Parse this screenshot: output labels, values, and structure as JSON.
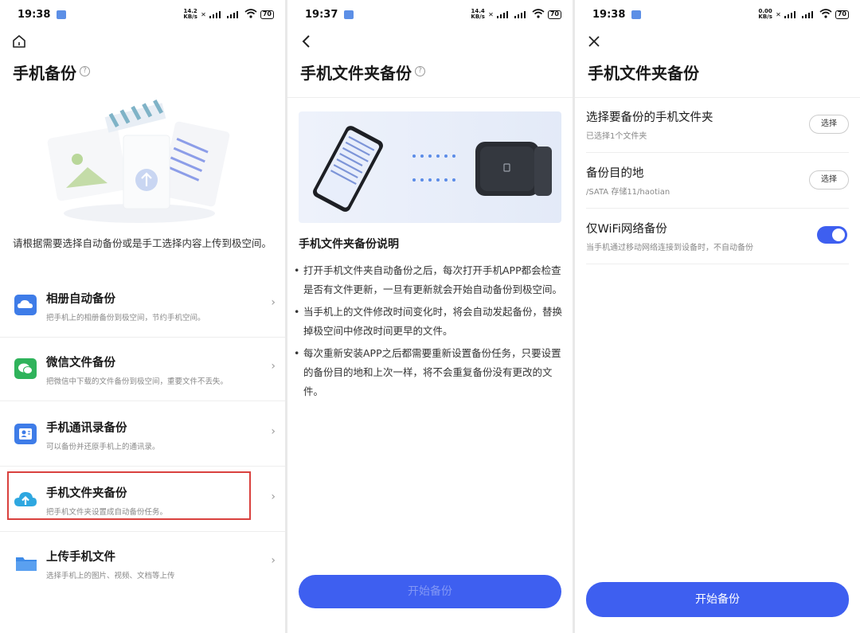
{
  "screens": [
    {
      "status_time": "19:38",
      "status_speed": "14.2 KB/s",
      "battery": "70",
      "title": "手机备份",
      "description": "请根据需要选择自动备份或是手工选择内容上传到极空间。",
      "items": [
        {
          "title": "相册自动备份",
          "subtitle": "把手机上的相册备份到极空间，节约手机空间。",
          "icon": "photo-cloud-icon",
          "color": "#3e7ce8"
        },
        {
          "title": "微信文件备份",
          "subtitle": "把微信中下载的文件备份到极空间，重要文件不丢失。",
          "icon": "wechat-icon",
          "color": "#2fb35b"
        },
        {
          "title": "手机通讯录备份",
          "subtitle": "可以备份并还原手机上的通讯录。",
          "icon": "contacts-icon",
          "color": "#3e7ce8"
        },
        {
          "title": "手机文件夹备份",
          "subtitle": "把手机文件夹设置成自动备份任务。",
          "icon": "cloud-upload-icon",
          "color": "#2ea7e0"
        },
        {
          "title": "上传手机文件",
          "subtitle": "选择手机上的图片、视频、文档等上传",
          "icon": "folder-icon",
          "color": "#3e8be8"
        }
      ]
    },
    {
      "status_time": "19:37",
      "status_speed": "14.4 KB/s",
      "battery": "70",
      "title": "手机文件夹备份",
      "section_title": "手机文件夹备份说明",
      "bullets": [
        "打开手机文件夹自动备份之后，每次打开手机APP都会检查是否有文件更新，一旦有更新就会开始自动备份到极空间。",
        "当手机上的文件修改时间变化时，将会自动发起备份，替换掉极空间中修改时间更早的文件。",
        "每次重新安装APP之后都需要重新设置备份任务，只要设置的备份目的地和上次一样，将不会重复备份没有更改的文件。"
      ],
      "button_label": "开始备份"
    },
    {
      "status_time": "19:38",
      "status_speed": "0.00 KB/s",
      "battery": "70",
      "title": "手机文件夹备份",
      "rows": [
        {
          "title": "选择要备份的手机文件夹",
          "subtitle": "已选择1个文件夹",
          "action": "选择"
        },
        {
          "title": "备份目的地",
          "subtitle": "/SATA 存储11/haotian",
          "action": "选择"
        },
        {
          "title": "仅WiFi网络备份",
          "subtitle": "当手机通过移动网络连接到设备时，不自动备份",
          "toggle_on": true
        }
      ],
      "button_label": "开始备份"
    }
  ],
  "accent_color": "#3e5ff0",
  "highlight_color": "#d9413e"
}
